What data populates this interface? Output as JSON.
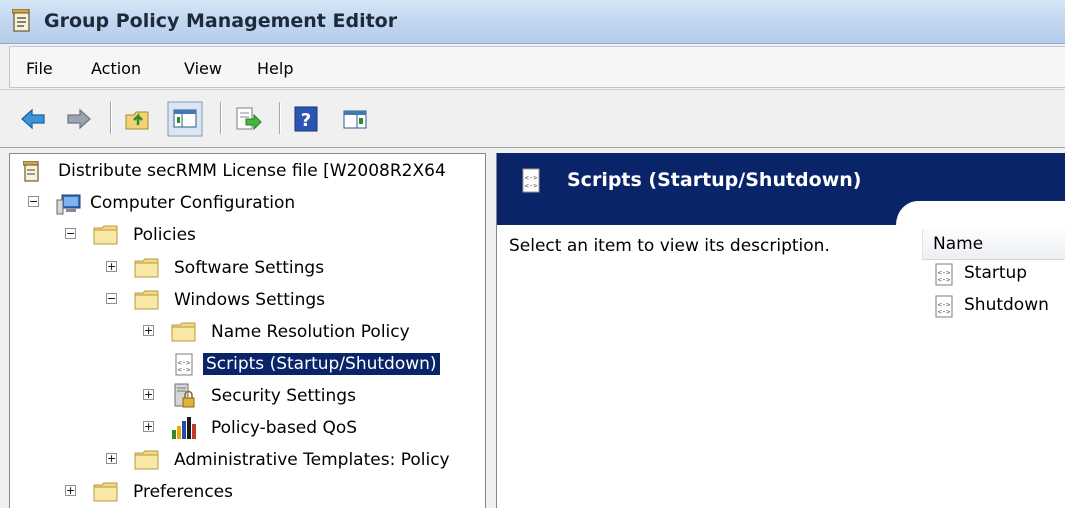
{
  "window": {
    "title": "Group Policy Management Editor"
  },
  "menu": [
    "File",
    "Action",
    "View",
    "Help"
  ],
  "toolbar": [
    "back",
    "forward",
    "up-one-level",
    "show-hide-console-tree",
    "export-list",
    "help",
    "show-hide-action-pane"
  ],
  "tree": {
    "root": "Distribute secRMM License file [W2008R2X64",
    "computer_configuration": "Computer Configuration",
    "policies": "Policies",
    "software_settings": "Software Settings",
    "windows_settings": "Windows Settings",
    "name_resolution_policy": "Name Resolution Policy",
    "scripts": "Scripts (Startup/Shutdown)",
    "security_settings": "Security Settings",
    "policy_qos": "Policy-based QoS",
    "admin_templates": "Administrative Templates: Policy",
    "preferences": "Preferences"
  },
  "details": {
    "header_title": "Scripts (Startup/Shutdown)",
    "description": "Select an item to view its description.",
    "column_name": "Name",
    "items": [
      "Startup",
      "Shutdown"
    ]
  },
  "colors": {
    "selection": "#0a246a",
    "header_bg": "#0a246a"
  }
}
